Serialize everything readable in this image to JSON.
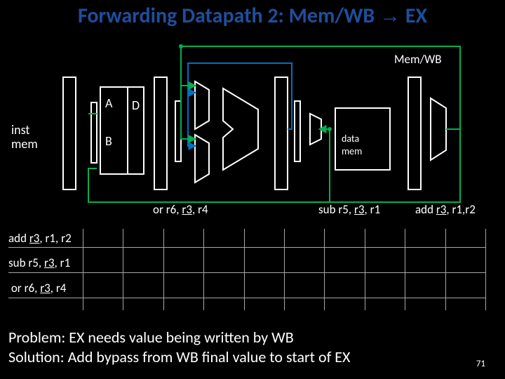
{
  "title": {
    "pre": "Forwarding Datapath 2: Mem/WB ",
    "arrow": "→",
    "post": " EX"
  },
  "labels": {
    "A": "A",
    "B": "B",
    "D": "D",
    "imem1": "inst",
    "imem2": "mem",
    "dmem1": "data",
    "dmem2": "mem",
    "memwb": "Mem/WB"
  },
  "instrs": [
    {
      "op": "add",
      "rd": "r3",
      "rs1": "r1",
      "rs2": "r2"
    },
    {
      "op": "sub",
      "rd": "r5",
      "rs1": "r3",
      "rs2": "r1"
    },
    {
      "op": "or",
      "rd": "r6",
      "rs1": "r3",
      "rs2": "r4"
    }
  ],
  "text": {
    "problem_label": "Problem:",
    "problem": "EX needs value being written by WB",
    "solution_label": "Solution:",
    "solution": "Add bypass from WB final value to start of EX"
  },
  "page": "71",
  "chart_data": {
    "type": "table",
    "description": "Pipeline timing grid: three instructions across 10 clock-cycle columns. Grid shown empty (no stage labels drawn).",
    "rows": [
      "add r3, r1, r2",
      "sub r5, r3, r1",
      "or r6, r3, r4"
    ],
    "cols": 10
  }
}
